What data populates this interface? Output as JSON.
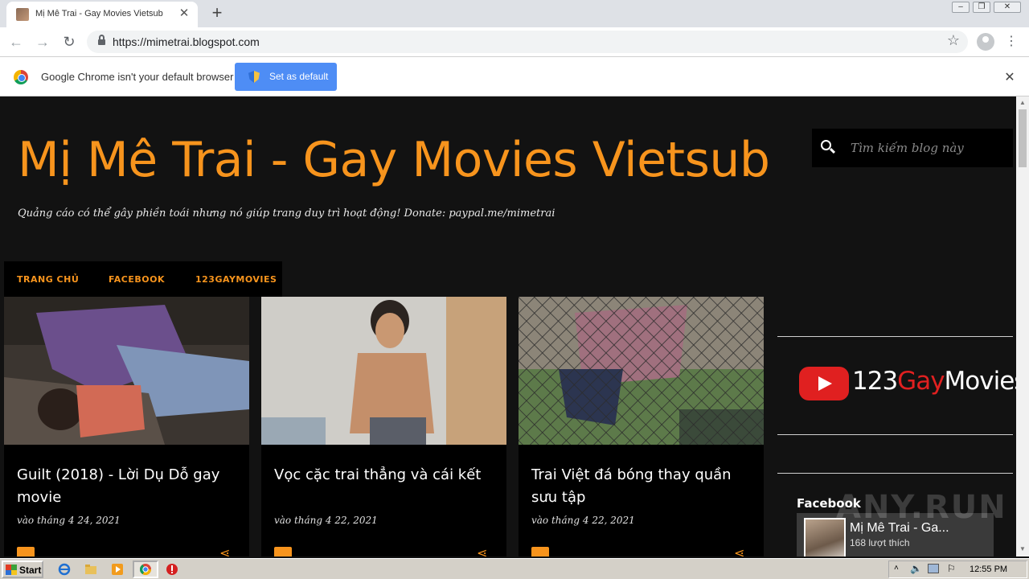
{
  "browser": {
    "tab_title": "Mị Mê Trai - Gay Movies Vietsub",
    "url": "https://mimetrai.blogspot.com",
    "infobar_text": "Google Chrome isn't your default browser",
    "set_default_label": "Set as default"
  },
  "blog": {
    "title": "Mị Mê Trai - Gay Movies Vietsub",
    "description": "Quảng cáo có thể gây phiền toái nhưng nó giúp trang duy trì hoạt động! Donate: paypal.me/mimetrai",
    "search_placeholder": "Tìm kiếm blog này",
    "nav": [
      "TRANG CHỦ",
      "FACEBOOK",
      "123GAYMOVIES"
    ]
  },
  "posts": [
    {
      "title": "Guilt (2018) - Lời Dụ Dỗ gay movie",
      "date": "vào tháng 4 24, 2021"
    },
    {
      "title": "Vọc cặc trai thẳng và cái kết",
      "date": "vào tháng 4 22, 2021"
    },
    {
      "title": "Trai Việt đá bóng thay quần sưu tập",
      "date": "vào tháng 4 22, 2021"
    }
  ],
  "sidebar": {
    "youtube_brand": {
      "part1": "123",
      "part2": "Gay",
      "part3": "Movies"
    },
    "facebook_heading": "Facebook",
    "fb_page_name": "Mị Mê Trai - Ga...",
    "fb_likes": "168 lượt thích"
  },
  "watermark": "ANY.RUN",
  "taskbar": {
    "start_label": "Start",
    "clock": "12:55 PM"
  },
  "colors": {
    "accent": "#f7941d",
    "page_bg": "#121212",
    "card_bg": "#000000",
    "youtube_red": "#e02020"
  }
}
